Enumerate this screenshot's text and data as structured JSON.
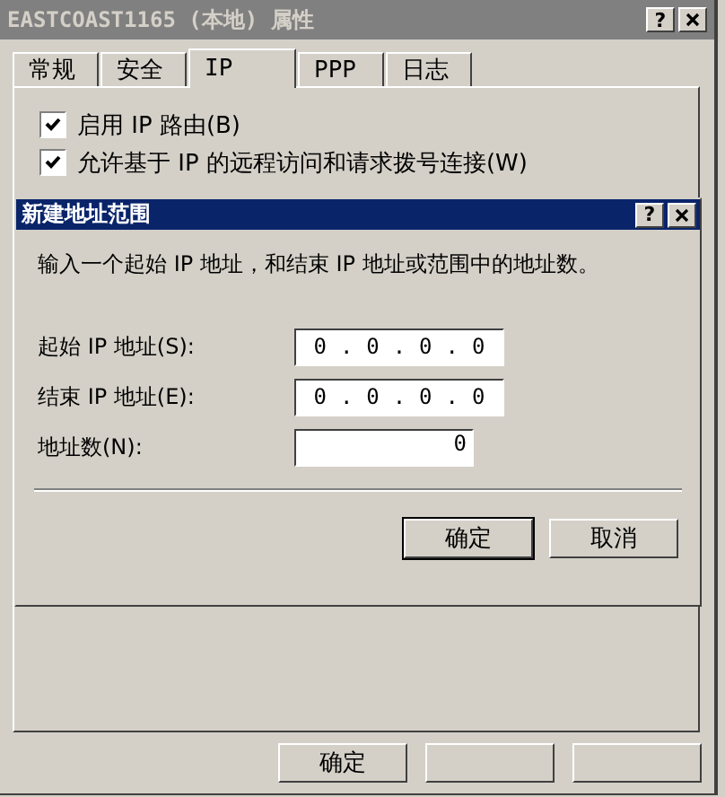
{
  "window": {
    "title": "EASTCOAST1165 (本地) 属性",
    "help": "?"
  },
  "tabs": [
    {
      "label": "常规",
      "selected": false
    },
    {
      "label": "安全",
      "selected": false
    },
    {
      "label": "IP",
      "selected": true
    },
    {
      "label": "PPP",
      "selected": false
    },
    {
      "label": "日志",
      "selected": false
    }
  ],
  "options": [
    {
      "label": "启用 IP 路由(B)",
      "checked": true
    },
    {
      "label": "允许基于 IP 的远程访问和请求拨号连接(W)",
      "checked": true
    }
  ],
  "dialog": {
    "title": "新建地址范围",
    "help": "?",
    "description": "输入一个起始 IP 地址，和结束 IP 地址或范围中的地址数。",
    "fields": [
      {
        "kind": "ip",
        "label": "起始 IP 地址(S):",
        "octets": [
          "0",
          "0",
          "0",
          "0"
        ],
        "separators": [
          ".",
          ".",
          "."
        ]
      },
      {
        "kind": "ip",
        "label": "结束 IP 地址(E):",
        "octets": [
          "0",
          "0",
          "0",
          "0"
        ],
        "separators": [
          ".",
          ".",
          "."
        ]
      },
      {
        "kind": "number",
        "label": "地址数(N):",
        "value": "0"
      }
    ],
    "buttons": [
      {
        "label": "确定",
        "default": true
      },
      {
        "label": "取消",
        "default": false
      }
    ]
  },
  "footer_buttons": [
    {
      "kind": "labeled",
      "label": "确定"
    },
    {
      "kind": "covered"
    },
    {
      "kind": "covered"
    }
  ]
}
